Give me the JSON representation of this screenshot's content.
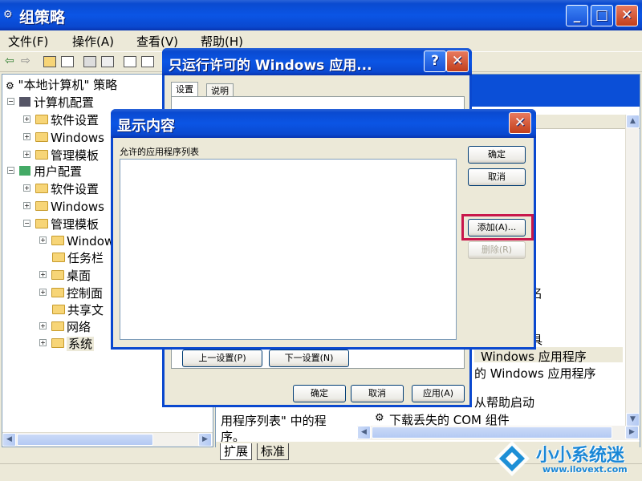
{
  "main_window": {
    "title": "组策略",
    "menu": [
      "文件(F)",
      "操作(A)",
      "查看(V)",
      "帮助(H)"
    ]
  },
  "tree": {
    "root": "\"本地计算机\" 策略",
    "nodes": [
      {
        "label": "计算机配置",
        "level": 1
      },
      {
        "label": "软件设置",
        "level": 2
      },
      {
        "label": "Windows",
        "level": 2
      },
      {
        "label": "管理模板",
        "level": 2
      },
      {
        "label": "用户配置",
        "level": 1
      },
      {
        "label": "软件设置",
        "level": 2
      },
      {
        "label": "Windows",
        "level": 2
      },
      {
        "label": "管理模板",
        "level": 2
      },
      {
        "label": "Window",
        "level": 3
      },
      {
        "label": "任务栏",
        "level": 3
      },
      {
        "label": "桌面",
        "level": 3
      },
      {
        "label": "控制面",
        "level": 3
      },
      {
        "label": "共享文",
        "level": 3
      },
      {
        "label": "网络",
        "level": 3
      },
      {
        "label": "系统",
        "level": 3
      }
    ]
  },
  "right_pane": {
    "frag_ming": "名",
    "frag_ju": "具",
    "item1": "Windows 应用程序",
    "item2": "的 Windows 应用程序",
    "item3": "从帮助启动",
    "item4": "下载丢失的 COM 组件",
    "desc_line1": "用程序列表\" 中的程",
    "desc_line2": "序。",
    "tab_expand": "扩展",
    "tab_standard": "标准"
  },
  "policy_dialog": {
    "title": "只运行许可的 Windows 应用...",
    "tabs": [
      "设置",
      "说明"
    ],
    "prev_button": "上一设置(P)",
    "next_button": "下一设置(N)",
    "ok": "确定",
    "cancel": "取消",
    "apply": "应用(A)"
  },
  "show_contents_dialog": {
    "title": "显示内容",
    "list_label": "允许的应用程序列表",
    "ok": "确定",
    "cancel": "取消",
    "add": "添加(A)...",
    "remove": "删除(R)"
  },
  "watermark": {
    "brand": "小小系统迷",
    "url": "www.ilovext.com"
  },
  "colors": {
    "highlight": "#c8174b",
    "title_blue": "#0b55e5"
  }
}
